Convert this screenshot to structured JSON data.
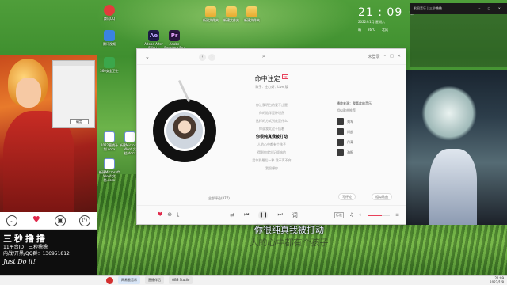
{
  "desktop": {
    "icons": [
      {
        "label": "腾讯QQ",
        "glyph": "g-red"
      },
      {
        "label": "腾讯视频",
        "glyph": "g-blue"
      },
      {
        "label": "Adobe After Effects",
        "glyph": "g-ae",
        "text": "Ae"
      },
      {
        "label": "Adobe Premiere Pro",
        "glyph": "g-pr",
        "text": "Pr"
      },
      {
        "label": "360安全卫士",
        "glyph": "g-green"
      },
      {
        "label": "新建文件夹",
        "glyph": "g-folder"
      },
      {
        "label": "新建文件夹",
        "glyph": "g-folder"
      },
      {
        "label": "新建文件夹",
        "glyph": "g-folder"
      },
      {
        "label": "2022营销计划.docx",
        "glyph": "g-doc"
      },
      {
        "label": "新建Microsoft Word 文档.docx",
        "glyph": "g-doc"
      },
      {
        "label": "新建Microsoft Word 文档.docx",
        "glyph": "g-doc"
      }
    ]
  },
  "streamer": {
    "brand": "三秒撸撸",
    "platform_id_label": "11平台ID：三秒撸撸",
    "contact": "内战/开黑/QQ群：136951812",
    "signature": "Just Do it!",
    "mini_button": "确定"
  },
  "clock": {
    "time": "21 : 09",
    "sub": "2022年1月 星期六",
    "row": [
      "晴",
      "26°C",
      "北风"
    ]
  },
  "right_panel": {
    "title": "发现音乐 | 三秒撸撸"
  },
  "player": {
    "song_title": "命中注定",
    "vip": "VIP",
    "artist": "歌手：庄心妍 / Live 版",
    "lyrics": [
      "你让我明白的爱不止是",
      "你的陪伴是种坦然",
      "这样的方式到底是什么",
      "你说我太过于执着",
      "你很纯真我被打动",
      "人的心中都有个孩子",
      "得到你就忘记烦恼的",
      "爱你到最后一秒 我不离不弃",
      "我很想你"
    ],
    "active_lyric_index": 4,
    "similar_heading": "播放来源：我喜欢的音乐",
    "similar_sub": "相似歌曲推荐",
    "similar": [
      "刘军",
      "肖战",
      "丹青",
      "海报"
    ],
    "comment_count": "全部评论(877)",
    "pill_1": "写评论",
    "pill_2": "相似歌曲",
    "account": "未登录",
    "quality": "标准"
  },
  "subtitle": {
    "line1": "你很纯真我被打动",
    "line2": "人的心中都有个孩子"
  },
  "taskbar": {
    "tasks": [
      "网易云音乐",
      "直播伴侣",
      "OBS Studio"
    ],
    "time": "21:09",
    "date": "2022/1/8"
  }
}
